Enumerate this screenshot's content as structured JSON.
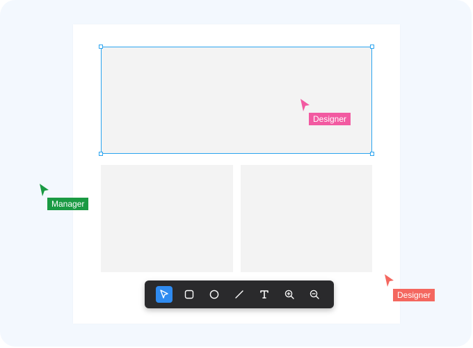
{
  "colors": {
    "stage_background": "#f3f8fe",
    "canvas_background": "#ffffff",
    "frame_fill": "#f3f3f3",
    "selection_border": "#2aa3ef",
    "toolbar_background": "#2a2a2c",
    "active_tool": "#2f8bf0"
  },
  "toolbar": {
    "tools": [
      {
        "name": "select",
        "icon": "cursor-arrow-icon",
        "active": true
      },
      {
        "name": "rectangle",
        "icon": "rounded-square-icon",
        "active": false
      },
      {
        "name": "ellipse",
        "icon": "circle-icon",
        "active": false
      },
      {
        "name": "line",
        "icon": "line-icon",
        "active": false
      },
      {
        "name": "text",
        "icon": "text-t-icon",
        "active": false
      },
      {
        "name": "zoom-in",
        "icon": "zoom-in-icon",
        "active": false
      },
      {
        "name": "zoom-out",
        "icon": "zoom-out-icon",
        "active": false
      }
    ]
  },
  "collaborators": [
    {
      "label": "Designer",
      "color": "#f25aa1"
    },
    {
      "label": "Manager",
      "color": "#1a9a43"
    },
    {
      "label": "Designer",
      "color": "#f4675f"
    }
  ]
}
